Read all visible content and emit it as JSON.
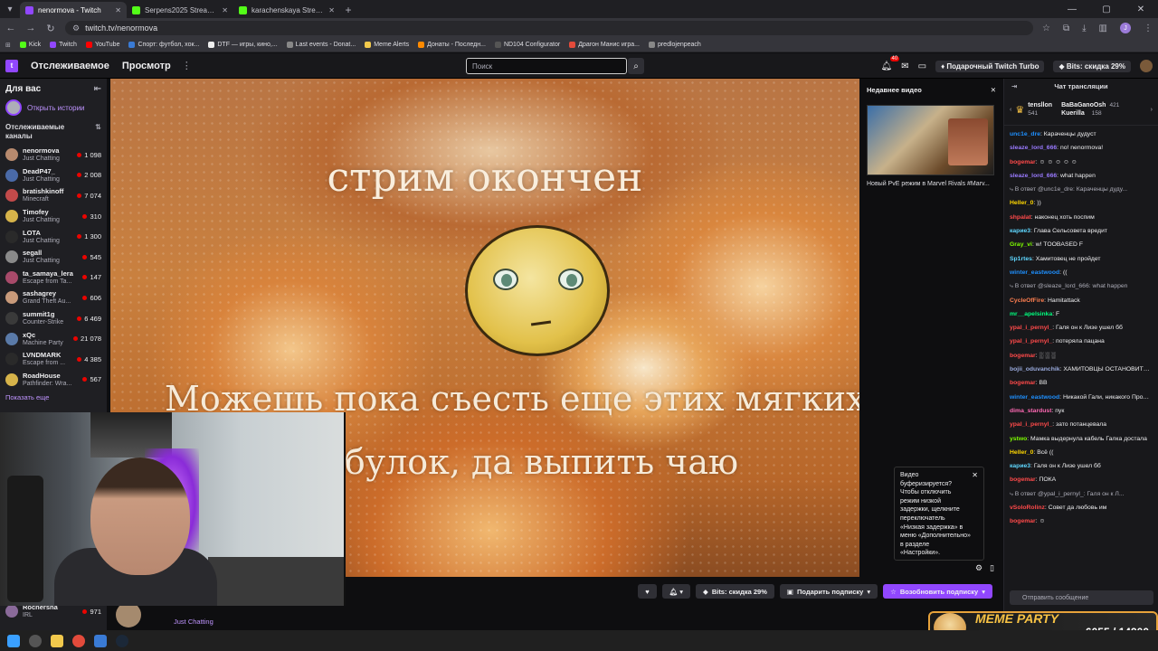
{
  "browser": {
    "tabs": [
      {
        "title": "nenormova - Twitch",
        "color": "#9147ff",
        "active": true
      },
      {
        "title": "Serpens2025 Stream - Watch L",
        "color": "#53fc18",
        "active": false
      },
      {
        "title": "karachenskaya Stream - Watch",
        "color": "#53fc18",
        "active": false
      }
    ],
    "url": "twitch.tv/nenormova",
    "bookmarks": [
      "Kick",
      "Twitch",
      "YouTube",
      "Спорт: футбол, хок...",
      "DTF — игры, кино,...",
      "Last events - Donat...",
      "Meme Alerts",
      "Донаты - Последн...",
      "ND104 Configurator",
      "Драгон Манис игра...",
      "predlojenpeach"
    ],
    "profile_initial": "J"
  },
  "topnav": {
    "following": "Отслеживаемое",
    "browse": "Просмотр",
    "search_placeholder": "Поиск",
    "notif_count": "40",
    "turbo": "Подарочный Twitch Turbo",
    "bits": "Bits: скидка 29%"
  },
  "sidebar": {
    "title": "Для вас",
    "stories": "Открыть истории",
    "section": "Отслеживаемые каналы",
    "channels": [
      {
        "name": "nenormova",
        "game": "Just Chatting",
        "viewers": "1 098",
        "color": "#b88a6e"
      },
      {
        "name": "DeadP47_",
        "game": "Just Chatting",
        "viewers": "2 008",
        "color": "#4a6aa8"
      },
      {
        "name": "bratishkinoff",
        "game": "Minecraft",
        "viewers": "7 074",
        "color": "#c24a4a"
      },
      {
        "name": "Timofey",
        "game": "Just Chatting",
        "viewers": "310",
        "color": "#d6b34a"
      },
      {
        "name": "LOTA",
        "game": "Just Chatting",
        "viewers": "1 300",
        "color": "#2a2a2a"
      },
      {
        "name": "segall",
        "game": "Just Chatting",
        "viewers": "545",
        "color": "#8a8a8a"
      },
      {
        "name": "ta_samaya_lera",
        "game": "Escape from Ta...",
        "viewers": "147",
        "color": "#a84a6a"
      },
      {
        "name": "sashagrey",
        "game": "Grand Theft Au...",
        "viewers": "606",
        "color": "#c89a7a"
      },
      {
        "name": "summit1g",
        "game": "Counter-Strike",
        "viewers": "6 469",
        "color": "#3a3a3a"
      },
      {
        "name": "xQc",
        "game": "Machine Party",
        "viewers": "21 078",
        "color": "#5a7aa8"
      },
      {
        "name": "LVNDMARK",
        "game": "Escape from ...",
        "viewers": "4 385",
        "color": "#2a2a2a"
      },
      {
        "name": "RoadHouse",
        "game": "Pathfinder: Wra...",
        "viewers": "567",
        "color": "#d6b34a"
      }
    ],
    "show_more": "Показать еще",
    "bottom_channels": [
      {
        "name": "Rochersha",
        "game": "IRL",
        "viewers": "971",
        "color": "#8a6a9a"
      }
    ]
  },
  "player": {
    "headline": "стрим окончен",
    "caption_line1": "Можешь пока съесть еще этих мягких",
    "caption_line2": "их булок, да выпить чаю"
  },
  "recent": {
    "title": "Недавнее видео",
    "video_title": "Новый PvE режим в Marvel Rivals #Marv..."
  },
  "tooltip": {
    "text": "Видео буферизируется? Чтобы отключить режим низкой задержки, щелкните переключатель «Низкая задержка» в меню «Дополнительно» в разделе «Настройки»."
  },
  "below": {
    "game": "Just Chatting",
    "bits_btn": "Bits: скидка 29%",
    "gift_btn": "Подарить подписку",
    "resub_btn": "Возобновить подписку"
  },
  "chat": {
    "title": "Чат трансляции",
    "pinned": [
      {
        "name": "tensllon",
        "count": "541"
      },
      {
        "name": "BaBaGanoOsh",
        "count": "421"
      },
      {
        "name": "Kuerilla",
        "count": "158"
      }
    ],
    "messages": [
      {
        "user": "unc1e_dre",
        "color": "#1e90ff",
        "text": "Караченцы дудуст"
      },
      {
        "user": "sleaze_lord_666",
        "color": "#9a7aff",
        "text": "no! nenormova!"
      },
      {
        "user": "bogemar",
        "color": "#ff4a4a",
        "text": "☺ ☺ ☺ ☺ ☺"
      },
      {
        "user": "sleaze_lord_666",
        "color": "#9a7aff",
        "text": "what happen"
      },
      {
        "user": "",
        "color": "#adadb8",
        "text": "В ответ @unc1e_dre: Караченцы дуду..."
      },
      {
        "user": "Heller_0",
        "color": "#ffd700",
        "text": "))"
      },
      {
        "user": "shpalat",
        "color": "#ff4a4a",
        "text": "наконец хоть поспим"
      },
      {
        "user": "карие3",
        "color": "#5fd7ff",
        "text": "Глава Сельсовета вредит"
      },
      {
        "user": "Gray_vi",
        "color": "#7fff00",
        "text": "w! TOOBASED F"
      },
      {
        "user": "Sp1rtes",
        "color": "#5fd7ff",
        "text": "Хамитовец не пройдет"
      },
      {
        "user": "winter_eastwood",
        "color": "#1e90ff",
        "text": "(("
      },
      {
        "user": "",
        "color": "#adadb8",
        "text": "В ответ @sleaze_lord_666: what happen"
      },
      {
        "user": "CycleOfFire",
        "color": "#ff7f50",
        "text": "Hamitattack"
      },
      {
        "user": "mr__apelsinka",
        "color": "#00ff7f",
        "text": "F"
      },
      {
        "user": "ypal_i_pernyl_",
        "color": "#ff4a4a",
        "text": "Галя он к Лизе ушел бб"
      },
      {
        "user": "ypal_i_pernyl_",
        "color": "#ff4a4a",
        "text": "потеряла пацана"
      },
      {
        "user": "bogemar",
        "color": "#ff4a4a",
        "text": "░ ░ ░"
      },
      {
        "user": "bojii_oduvanchik",
        "color": "#9ad",
        "text": "ХАМИТОВЦЫ ОСТАНОВИТЕСЬ"
      },
      {
        "user": "bogemar",
        "color": "#ff4a4a",
        "text": "BB"
      },
      {
        "user": "winter_eastwood",
        "color": "#1e90ff",
        "text": "Никакой Гали, никакого Продиджи, никакого праздника ("
      },
      {
        "user": "dima_stardust",
        "color": "#ff69b4",
        "text": "пук"
      },
      {
        "user": "ypal_i_pernyl_",
        "color": "#ff4a4a",
        "text": "зато потанцевала"
      },
      {
        "user": "ystwo",
        "color": "#7fff00",
        "text": "Мамка выдернула кабель Галка достала"
      },
      {
        "user": "Heller_0",
        "color": "#ffd700",
        "text": "Всё (("
      },
      {
        "user": "карие3",
        "color": "#5fd7ff",
        "text": "Галя он к Лизе ушел бб"
      },
      {
        "user": "bogemar",
        "color": "#ff4a4a",
        "text": "ПОКА"
      },
      {
        "user": "",
        "color": "#adadb8",
        "text": "В ответ @ypal_i_pernyl_: Галя он к Л..."
      },
      {
        "user": "vSoloRolinz",
        "color": "#ff4a4a",
        "text": "Совет да любовь им"
      },
      {
        "user": "bogemar",
        "color": "#ff4a4a",
        "text": "☺"
      }
    ],
    "input_placeholder": "Отправить сообщение"
  },
  "overlay": {
    "meme_title": "MEME PARTY",
    "meme_count": "6055 / 14900"
  }
}
